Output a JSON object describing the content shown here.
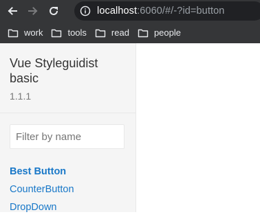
{
  "browser": {
    "url_host": "localhost",
    "url_rest": ":6060/#/-?id=button",
    "icons": {
      "back": "arrow-left-icon",
      "forward": "arrow-right-icon",
      "reload": "reload-icon",
      "info": "info-icon",
      "folder": "folder-icon"
    }
  },
  "bookmarks": [
    "work",
    "tools",
    "read",
    "people"
  ],
  "sidebar": {
    "title": "Vue Styleguidist basic",
    "version": "1.1.1",
    "filter_placeholder": "Filter by name",
    "items": [
      {
        "label": "Best Button",
        "active": true
      },
      {
        "label": "CounterButton",
        "active": false
      },
      {
        "label": "DropDown",
        "active": false
      }
    ]
  },
  "colors": {
    "browser_chrome": "#353638",
    "address_bar": "#202124",
    "sidebar_bg": "#f5f5f5",
    "link": "#1978c8"
  }
}
